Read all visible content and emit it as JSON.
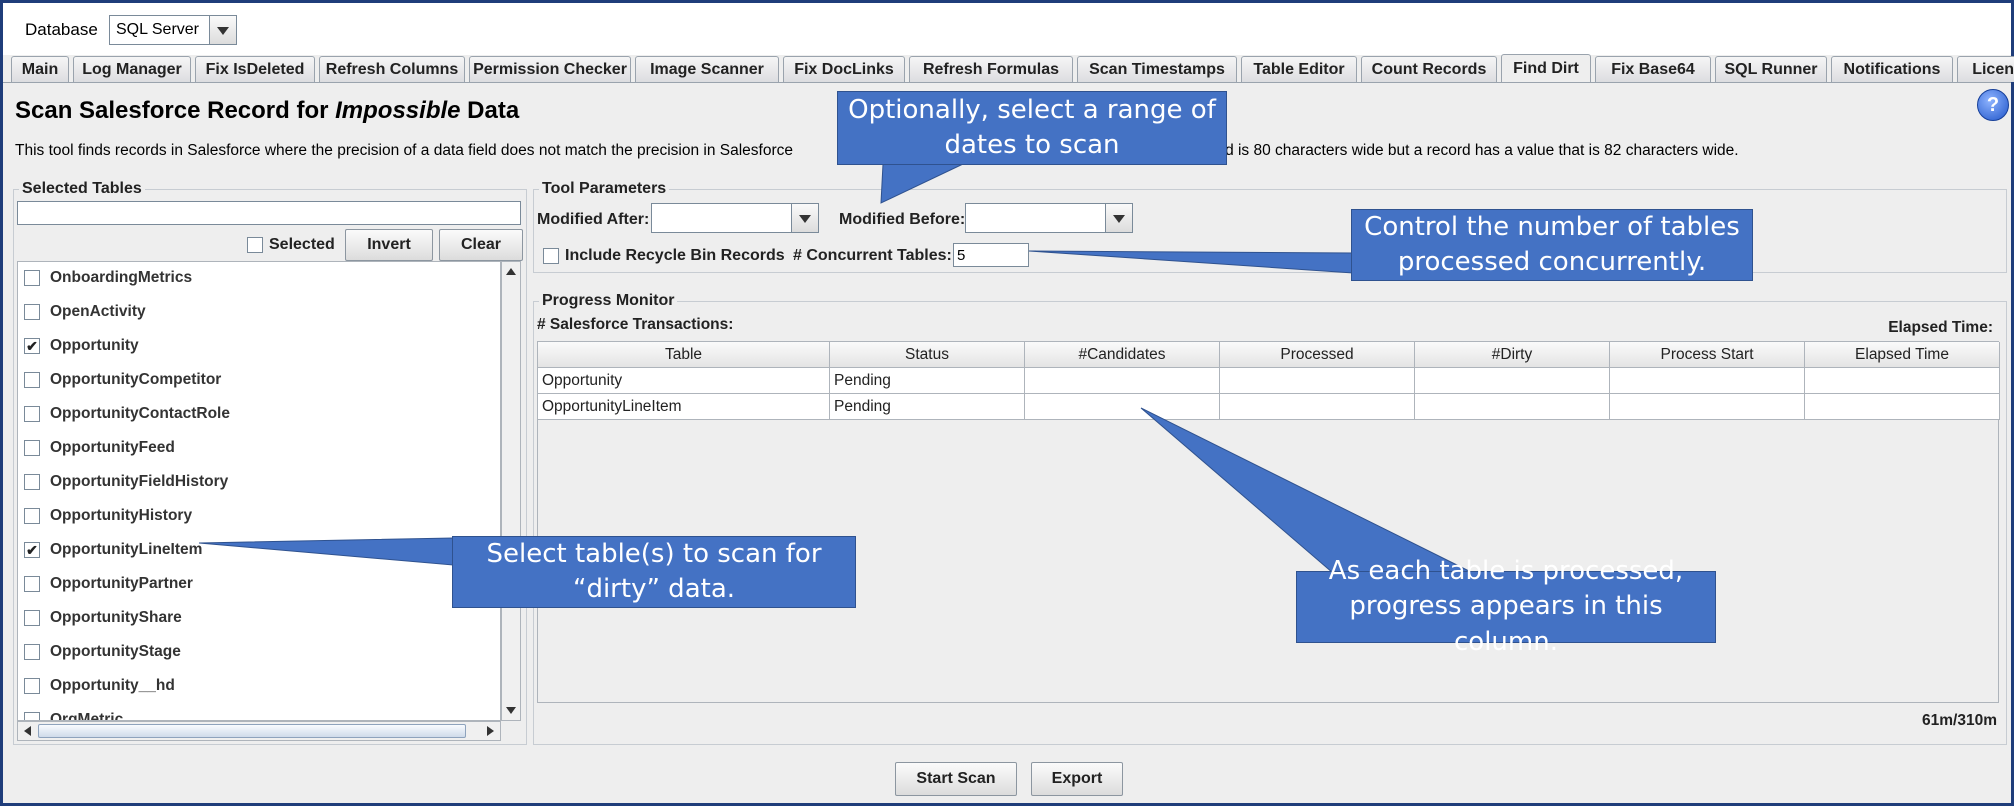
{
  "topbar": {
    "database_label": "Database",
    "database_value": "SQL Server"
  },
  "tabs": [
    "Main",
    "Log Manager",
    "Fix IsDeleted",
    "Refresh Columns",
    "Permission Checker",
    "Image Scanner",
    "Fix DocLinks",
    "Refresh Formulas",
    "Scan Timestamps",
    "Table Editor",
    "Count Records",
    "Find Dirt",
    "Fix Base64",
    "SQL Runner",
    "Notifications",
    "License"
  ],
  "active_tab": "Find Dirt",
  "page": {
    "title_prefix": "Scan Salesforce Record for ",
    "title_emphasis": "Impossible",
    "title_suffix": " Data",
    "description_left": "This tool finds records in Salesforce where the precision of a data field does not match the precision in Salesforce",
    "description_right": "eld is 80 characters wide but a record has a value that is 82 characters wide."
  },
  "selected_tables": {
    "title": "Selected Tables",
    "filter_value": "",
    "selected_label": "Selected",
    "invert_label": "Invert",
    "clear_label": "Clear",
    "items": [
      {
        "name": "OnboardingMetrics",
        "checked": false
      },
      {
        "name": "OpenActivity",
        "checked": false
      },
      {
        "name": "Opportunity",
        "checked": true
      },
      {
        "name": "OpportunityCompetitor",
        "checked": false
      },
      {
        "name": "OpportunityContactRole",
        "checked": false
      },
      {
        "name": "OpportunityFeed",
        "checked": false
      },
      {
        "name": "OpportunityFieldHistory",
        "checked": false
      },
      {
        "name": "OpportunityHistory",
        "checked": false
      },
      {
        "name": "OpportunityLineItem",
        "checked": true
      },
      {
        "name": "OpportunityPartner",
        "checked": false
      },
      {
        "name": "OpportunityShare",
        "checked": false
      },
      {
        "name": "OpportunityStage",
        "checked": false
      },
      {
        "name": "Opportunity__hd",
        "checked": false
      },
      {
        "name": "OrgMetric",
        "checked": false
      }
    ]
  },
  "tool_parameters": {
    "title": "Tool Parameters",
    "modified_after_label": "Modified After:",
    "modified_after_value": "",
    "modified_before_label": "Modified Before:",
    "modified_before_value": "",
    "recycle_bin_label": "Include Recycle Bin Records",
    "concurrent_label": "# Concurrent Tables:",
    "concurrent_value": "5"
  },
  "progress": {
    "title": "Progress Monitor",
    "transactions_label": "# Salesforce Transactions:",
    "elapsed_label": "Elapsed Time:",
    "columns": [
      "Table",
      "Status",
      "#Candidates",
      "Processed",
      "#Dirty",
      "Process Start",
      "Elapsed Time"
    ],
    "rows": [
      [
        "Opportunity",
        "Pending",
        "",
        "",
        "",
        "",
        ""
      ],
      [
        "OpportunityLineItem",
        "Pending",
        "",
        "",
        "",
        "",
        ""
      ]
    ],
    "memory": "61m/310m"
  },
  "buttons": {
    "start_scan": "Start Scan",
    "export": "Export"
  },
  "callouts": {
    "dates": "Optionally, select a range of dates to scan",
    "concurrent": "Control the number of tables processed concurrently.",
    "select": "Select table(s) to scan for “dirty” data.",
    "progress": "As each table is processed, progress appears in this column."
  },
  "colors": {
    "callout": "#4472c4",
    "frame": "#1f3d7a",
    "panel": "#eeeeee"
  }
}
